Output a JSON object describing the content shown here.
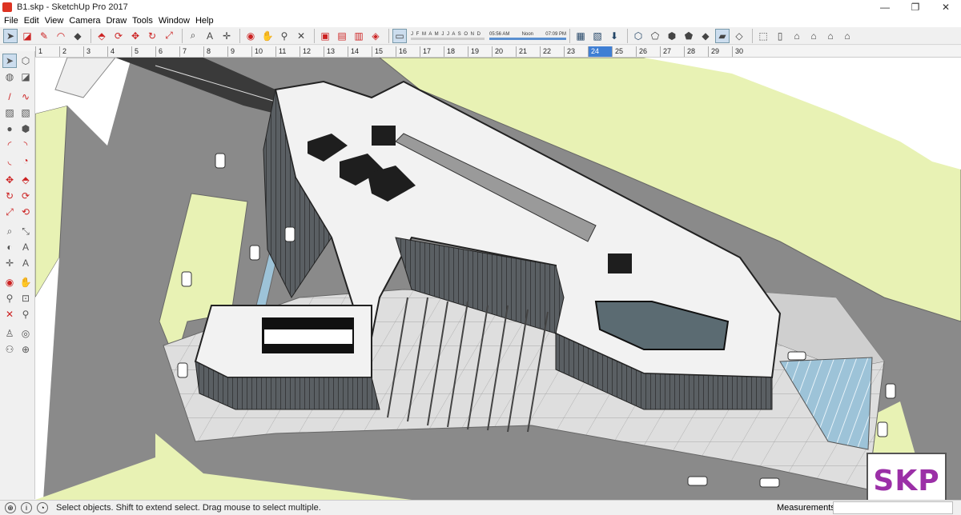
{
  "window": {
    "title": "B1.skp - SketchUp Pro 2017",
    "minimize": "—",
    "maximize": "❐",
    "close": "✕"
  },
  "menu": [
    "File",
    "Edit",
    "View",
    "Camera",
    "Draw",
    "Tools",
    "Window",
    "Help"
  ],
  "shadows": {
    "months": "J F M A M J J A S O N D",
    "time_start": "05:56 AM",
    "time_mid": "Noon",
    "time_end": "07:09 PM"
  },
  "scenes": [
    "1",
    "2",
    "3",
    "4",
    "5",
    "6",
    "7",
    "8",
    "9",
    "10",
    "11",
    "12",
    "13",
    "14",
    "15",
    "16",
    "17",
    "18",
    "19",
    "20",
    "21",
    "22",
    "23",
    "24",
    "25",
    "26",
    "27",
    "28",
    "29",
    "30"
  ],
  "active_scene": "24",
  "status": {
    "hint": "Select objects. Shift to extend select. Drag mouse to select multiple.",
    "measurements_label": "Measurements",
    "measurements_value": ""
  },
  "watermark": "SKP",
  "colors": {
    "accent": "#3f7fd4",
    "road": "#8a8a8a",
    "grass": "#e8f2b4",
    "plaza": "#d9d9d9",
    "roof": "#f2f2f2",
    "glass": "#9dc3d8",
    "watermark": "#9b2fa7"
  }
}
